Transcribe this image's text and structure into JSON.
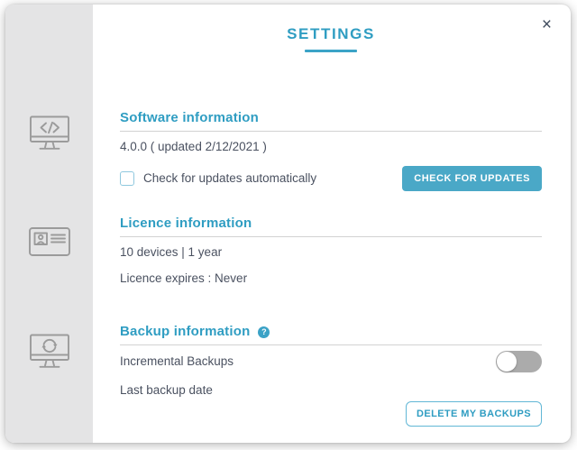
{
  "window": {
    "title": "SETTINGS",
    "close_icon": "×"
  },
  "sidebar": {
    "icons": [
      {
        "name": "monitor-code-icon",
        "section": "software"
      },
      {
        "name": "id-card-icon",
        "section": "licence"
      },
      {
        "name": "monitor-sync-icon",
        "section": "backup"
      }
    ]
  },
  "software": {
    "heading": "Software information",
    "version": "4.0.0 ( updated 2/12/2021 )",
    "checkbox_label": "Check for updates automatically",
    "checkbox_checked": false,
    "check_updates_button": "CHECK FOR UPDATES"
  },
  "licence": {
    "heading": "Licence information",
    "devices_line": "10 devices | 1 year",
    "expires_line": "Licence expires : Never"
  },
  "backup": {
    "heading": "Backup information",
    "help_icon": "?",
    "incremental_label": "Incremental Backups",
    "incremental_enabled": false,
    "last_backup_label": "Last backup date",
    "delete_button": "DELETE MY BACKUPS"
  },
  "colors": {
    "accent_teal": "#2F9DC2",
    "button_teal": "#4AA8C7",
    "outline_button_border": "#62B7D6",
    "text_dark": "#4A5160",
    "sidebar_gray": "#E4E4E5",
    "icon_gray": "#9B9B9B",
    "divider_gray": "#D2D2D2",
    "toggle_off_gray": "#ABABAB",
    "close_icon_color": "#3E4A5C"
  }
}
